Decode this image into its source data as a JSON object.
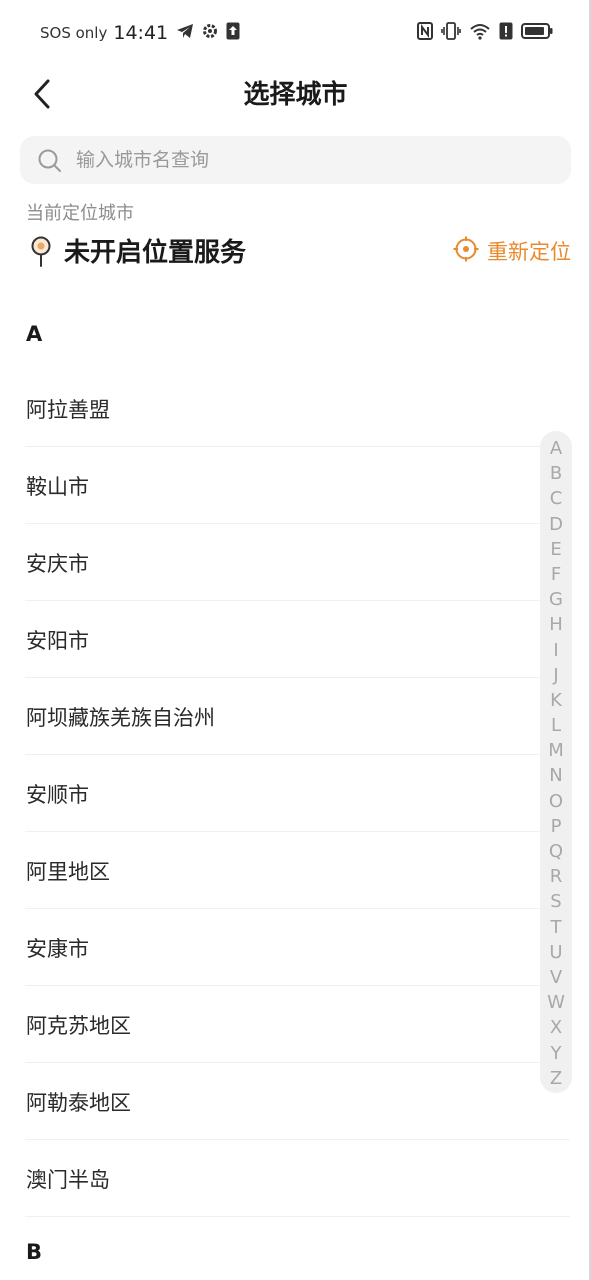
{
  "status_bar": {
    "carrier": "SOS only",
    "time": "14:41"
  },
  "header": {
    "title": "选择城市"
  },
  "search": {
    "placeholder": "输入城市名查询"
  },
  "location": {
    "label": "当前定位城市",
    "status": "未开启位置服务",
    "relocate_label": "重新定位"
  },
  "colors": {
    "accent": "#e88a2e"
  },
  "sections": [
    {
      "letter": "A",
      "cities": [
        "阿拉善盟",
        "鞍山市",
        "安庆市",
        "安阳市",
        "阿坝藏族羌族自治州",
        "安顺市",
        "阿里地区",
        "安康市",
        "阿克苏地区",
        "阿勒泰地区",
        "澳门半岛"
      ]
    },
    {
      "letter": "B",
      "cities": []
    }
  ],
  "index_letters": [
    "A",
    "B",
    "C",
    "D",
    "E",
    "F",
    "G",
    "H",
    "I",
    "J",
    "K",
    "L",
    "M",
    "N",
    "O",
    "P",
    "Q",
    "R",
    "S",
    "T",
    "U",
    "V",
    "W",
    "X",
    "Y",
    "Z"
  ]
}
